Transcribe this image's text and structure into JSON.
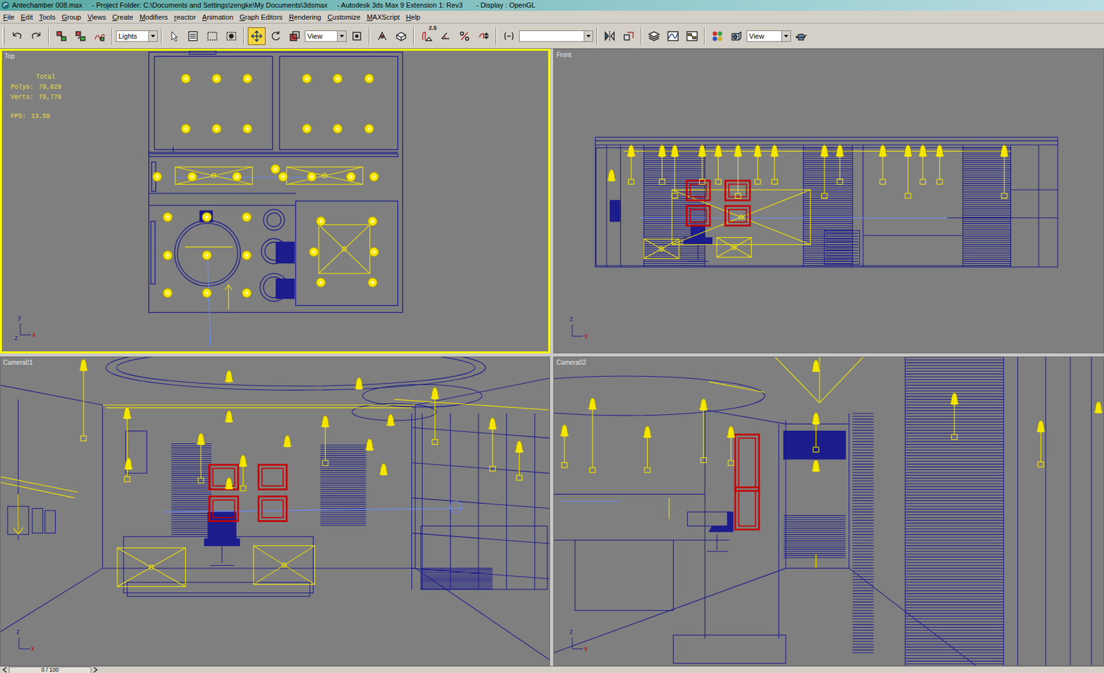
{
  "window": {
    "title": "Antechamber 008.max     - Project Folder: C:\\Documents and Settings\\zengke\\My Documents\\3dsmax     - Autodesk 3ds Max 9 Extension 1: Rev3       - Display : OpenGL"
  },
  "menu": [
    "File",
    "Edit",
    "Tools",
    "Group",
    "Views",
    "Create",
    "Modifiers",
    "reactor",
    "Animation",
    "Graph Editors",
    "Rendering",
    "Customize",
    "MAXScript",
    "Help"
  ],
  "toolbar": {
    "selection_filter": "Lights",
    "reference_coord": "View",
    "snap_label": "2.5",
    "render_preset": "View",
    "select_tools": [
      {
        "selected": false
      },
      {
        "selected": false
      },
      {
        "selected": false
      },
      {
        "selected": false
      },
      {
        "selected": true
      },
      {
        "selected": false
      },
      {
        "selected": false
      }
    ]
  },
  "viewports": [
    {
      "label": "Top",
      "active": true,
      "axis": {
        "up": "y",
        "corner": "z",
        "right": "x"
      },
      "stats": {
        "title": "Total",
        "rows": [
          {
            "label": "Polys:",
            "value": "79,029"
          },
          {
            "label": "Verts:",
            "value": "79,776"
          },
          {
            "label": "FPS:",
            "value": "13.59"
          }
        ]
      }
    },
    {
      "label": "Front",
      "active": false,
      "axis": {
        "up": "z",
        "right": "x"
      }
    },
    {
      "label": "Camera01",
      "active": false,
      "axis": {
        "up": "z",
        "right": "x"
      }
    },
    {
      "label": "Camera02",
      "active": false,
      "axis": {
        "up": "z",
        "right": "x"
      }
    }
  ],
  "time_slider": {
    "label": "0 / 100"
  }
}
